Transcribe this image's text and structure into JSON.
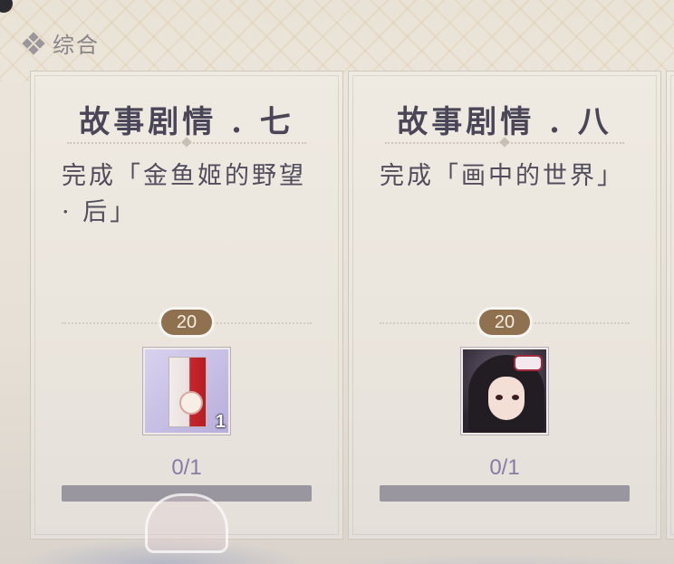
{
  "section": {
    "title": "综合",
    "icon": "diamond-cluster-icon"
  },
  "cards": [
    {
      "title": "故事剧情 . 七",
      "description": "完成「金鱼姬的野望 · 后」",
      "points": "20",
      "reward": {
        "icon": "paper-card-item-icon",
        "count": "1"
      },
      "progress_text": "0/1",
      "progress_fraction": 0
    },
    {
      "title": "故事剧情 . 八",
      "description": "完成「画中的世界」",
      "points": "20",
      "reward": {
        "icon": "character-portrait-icon",
        "count": ""
      },
      "progress_text": "0/1",
      "progress_fraction": 0
    }
  ],
  "colors": {
    "points_badge": "#8f7150",
    "progress_text": "#8a7aa8",
    "progress_track": "#9a96a0"
  }
}
